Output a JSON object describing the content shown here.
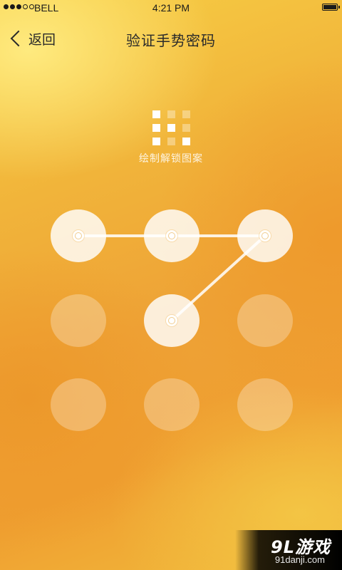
{
  "status_bar": {
    "signal_dots": 5,
    "signal_filled": 3,
    "carrier": "BELL",
    "time": "4:21 PM",
    "battery_level": 1.0
  },
  "nav": {
    "back_label": "返回",
    "title": "验证手势密码"
  },
  "preview": {
    "grid": [
      [
        true,
        false,
        false
      ],
      [
        true,
        true,
        false
      ],
      [
        true,
        false,
        true
      ]
    ],
    "hint": "绘制解锁图案"
  },
  "pattern": {
    "rows": 3,
    "cols": 3,
    "active_nodes": [
      0,
      1,
      2,
      4
    ],
    "path": [
      0,
      1,
      2,
      4
    ]
  },
  "watermark": {
    "brand": "9L游戏",
    "url": "91danji.com"
  },
  "colors": {
    "background_top": "#f7cf45",
    "background_mid": "#eea236",
    "background_bottom": "#f1bb3c",
    "text_dark": "#2a2a2a",
    "node_active": "#ffffff",
    "node_inactive": "rgba(255,255,255,0.28)"
  }
}
